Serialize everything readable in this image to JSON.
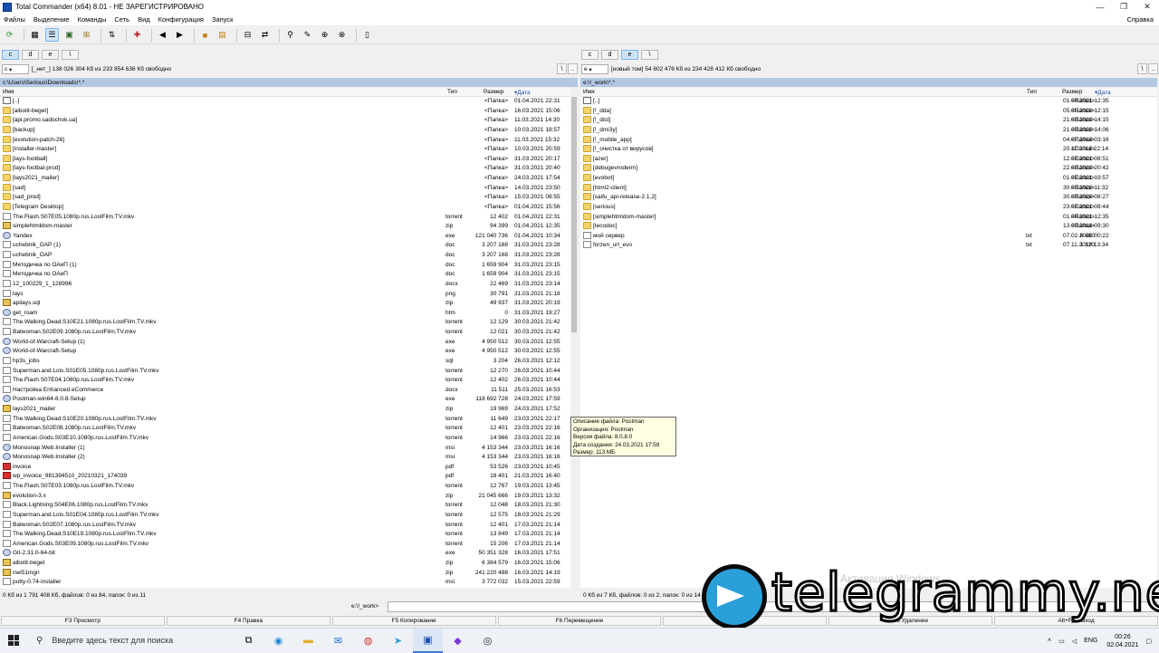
{
  "window": {
    "title": "Total Commander (x64) 8.01 - НЕ ЗАРЕГИСТРИРОВАНО",
    "controls": [
      "—",
      "❐",
      "✕"
    ]
  },
  "menu": {
    "items": [
      "Файлы",
      "Выделение",
      "Команды",
      "Сеть",
      "Вид",
      "Конфигурация",
      "Запуск"
    ],
    "help": "Справка"
  },
  "toolbar": {
    "icons": [
      "refresh-icon",
      "brief-view-icon",
      "detailed-view-icon",
      "thumbnails-icon",
      "tree-icon",
      "invert-selection-icon",
      "pack-icon",
      "back-icon",
      "forward-icon",
      "pack-files-icon",
      "unpack-icon",
      "compare-dirs-icon",
      "sync-dirs-icon",
      "search-icon",
      "multi-rename-icon",
      "ftp-icon",
      "url-ftp-icon",
      "notepad-icon"
    ]
  },
  "left": {
    "drives": [
      "c",
      "d",
      "e",
      "\\"
    ],
    "drive_combo": "c",
    "volume": "[_нет_]",
    "free_info": "138 026 304 Кб из 233 854 636 Кб свободно",
    "path": "c:\\Users\\Serious\\Downloads\\*.*",
    "headers": {
      "name": "Имя",
      "type": "Тип",
      "size": "Размер",
      "date": "Дата"
    },
    "rows": [
      {
        "icon": "up",
        "name": "[..]",
        "type": "",
        "size": "<Папка>",
        "date": "01.04.2021 22:31"
      },
      {
        "icon": "folder",
        "name": "[aibolit-beget]",
        "type": "",
        "size": "<Папка>",
        "date": "16.03.2021 15:06"
      },
      {
        "icon": "folder",
        "name": "[api.promo.sadochok.ua]",
        "type": "",
        "size": "<Папка>",
        "date": "11.03.2021 14:30"
      },
      {
        "icon": "folder",
        "name": "[backup]",
        "type": "",
        "size": "<Папка>",
        "date": "10.03.2021 18:57"
      },
      {
        "icon": "folder",
        "name": "[evolution-patch-26]",
        "type": "",
        "size": "<Папка>",
        "date": "11.03.2021 15:32"
      },
      {
        "icon": "folder",
        "name": "[installer-master]",
        "type": "",
        "size": "<Папка>",
        "date": "10.03.2021 20:59"
      },
      {
        "icon": "folder",
        "name": "[lays-football]",
        "type": "",
        "size": "<Папка>",
        "date": "31.03.2021 20:17"
      },
      {
        "icon": "folder",
        "name": "[lays-footbal-prod]",
        "type": "",
        "size": "<Папка>",
        "date": "31.03.2021 20:40"
      },
      {
        "icon": "folder",
        "name": "[lays2021_mailer]",
        "type": "",
        "size": "<Папка>",
        "date": "24.03.2021 17:54"
      },
      {
        "icon": "folder",
        "name": "[sad]",
        "type": "",
        "size": "<Папка>",
        "date": "14.03.2021 23:50"
      },
      {
        "icon": "folder",
        "name": "[sad_prod]",
        "type": "",
        "size": "<Папка>",
        "date": "15.03.2021 08:55"
      },
      {
        "icon": "folder",
        "name": "[Telegram Desktop]",
        "type": "",
        "size": "<Папка>",
        "date": "01.04.2021 15:56"
      },
      {
        "icon": "file",
        "name": "The.Flash.S07E05.1080p.rus.LostFilm.TV.mkv",
        "type": "torrent",
        "size": "12 402",
        "date": "01.04.2021 22:31"
      },
      {
        "icon": "zip",
        "name": "simplehtmldom-master",
        "type": "zip",
        "size": "94 399",
        "date": "01.04.2021 12:35"
      },
      {
        "icon": "exe",
        "name": "Yandex",
        "type": "exe",
        "size": "121 040 736",
        "date": "01.04.2021 10:34"
      },
      {
        "icon": "file",
        "name": "uchebnik_OAP (1)",
        "type": "doc",
        "size": "3 207 168",
        "date": "31.03.2021 23:28"
      },
      {
        "icon": "file",
        "name": "uchebnik_OAP",
        "type": "doc",
        "size": "3 207 168",
        "date": "31.03.2021 23:28"
      },
      {
        "icon": "file",
        "name": "Методичка по ОАиП (1)",
        "type": "doc",
        "size": "1 659 904",
        "date": "31.03.2021 23:15"
      },
      {
        "icon": "file",
        "name": "Методичка по ОАиП",
        "type": "doc",
        "size": "1 659 904",
        "date": "31.03.2021 23:15"
      },
      {
        "icon": "file",
        "name": "12_100229_1_128996",
        "type": "docx",
        "size": "22 469",
        "date": "31.03.2021 23:14"
      },
      {
        "icon": "file",
        "name": "lays",
        "type": "png",
        "size": "30 791",
        "date": "31.03.2021 21:18"
      },
      {
        "icon": "zip",
        "name": "apilays.sql",
        "type": "zip",
        "size": "49 937",
        "date": "31.03.2021 20:19"
      },
      {
        "icon": "exe",
        "name": "get_roam",
        "type": "htm",
        "size": "0",
        "date": "31.03.2021 19:27"
      },
      {
        "icon": "file",
        "name": "The.Walking.Dead.S10E21.1080p.rus.LostFilm.TV.mkv",
        "type": "torrent",
        "size": "12 129",
        "date": "30.03.2021 21:42"
      },
      {
        "icon": "file",
        "name": "Batwoman.S02E09.1080p.rus.LostFilm.TV.mkv",
        "type": "torrent",
        "size": "12 021",
        "date": "30.03.2021 21:42"
      },
      {
        "icon": "exe",
        "name": "World-of-Warcraft-Setup (1)",
        "type": "exe",
        "size": "4 950 512",
        "date": "30.03.2021 12:55"
      },
      {
        "icon": "exe",
        "name": "World-of-Warcraft-Setup",
        "type": "exe",
        "size": "4 950 512",
        "date": "30.03.2021 12:55"
      },
      {
        "icon": "file",
        "name": "hp3s_jobs",
        "type": "sql",
        "size": "3 204",
        "date": "26.03.2021 12:12"
      },
      {
        "icon": "file",
        "name": "Superman.and.Lois.S01E05.1080p.rus.LostFilm.TV.mkv",
        "type": "torrent",
        "size": "12 270",
        "date": "26.03.2021 10:44"
      },
      {
        "icon": "file",
        "name": "The.Flash.S07E04.1080p.rus.LostFilm.TV.mkv",
        "type": "torrent",
        "size": "12 402",
        "date": "26.03.2021 10:44"
      },
      {
        "icon": "file",
        "name": "Настройка Enhanced eCommerce",
        "type": "docx",
        "size": "11 511",
        "date": "25.03.2021 16:53"
      },
      {
        "icon": "exe",
        "name": "Postman-win64-8.0.8-Setup",
        "type": "exe",
        "size": "118 692 728",
        "date": "24.03.2021 17:59"
      },
      {
        "icon": "zip",
        "name": "lays2021_mailer",
        "type": "zip",
        "size": "19 969",
        "date": "24.03.2021 17:52"
      },
      {
        "icon": "file",
        "name": "The.Walking.Dead.S10E20.1080p.rus.LostFilm.TV.mkv",
        "type": "torrent",
        "size": "11 649",
        "date": "23.03.2021 22:17"
      },
      {
        "icon": "file",
        "name": "Batwoman.S02E08.1080p.rus.LostFilm.TV.mkv",
        "type": "torrent",
        "size": "12 401",
        "date": "23.03.2021 22:16"
      },
      {
        "icon": "file",
        "name": "American.Gods.S03E10.1080p.rus.LostFilm.TV.mkv",
        "type": "torrent",
        "size": "14 966",
        "date": "23.03.2021 22:16"
      },
      {
        "icon": "exe",
        "name": "Monosnap.Web.Installer (1)",
        "type": "msi",
        "size": "4 153 344",
        "date": "23.03.2021 16:16"
      },
      {
        "icon": "exe",
        "name": "Monosnap.Web.Installer (2)",
        "type": "msi",
        "size": "4 153 344",
        "date": "23.03.2021 16:16"
      },
      {
        "icon": "pdf",
        "name": "invoice",
        "type": "pdf",
        "size": "53 526",
        "date": "23.03.2021 10:45"
      },
      {
        "icon": "pdf",
        "name": "wp_invoice_981394510_20210321_174039",
        "type": "pdf",
        "size": "18 401",
        "date": "21.03.2021 16:40"
      },
      {
        "icon": "file",
        "name": "The.Flash.S07E03.1080p.rus.LostFilm.TV.mkv",
        "type": "torrent",
        "size": "12 767",
        "date": "19.03.2021 13:45"
      },
      {
        "icon": "zip",
        "name": "evolution-3.x",
        "type": "zip",
        "size": "21 045 666",
        "date": "19.03.2021 13:32"
      },
      {
        "icon": "file",
        "name": "Black.Lightning.S04E06.1080p.rus.LostFilm.TV.mkv",
        "type": "torrent",
        "size": "12 048",
        "date": "18.03.2021 21:30"
      },
      {
        "icon": "file",
        "name": "Superman.and.Lois.S01E04.1080p.rus.LostFilm.TV.mkv",
        "type": "torrent",
        "size": "12 575",
        "date": "18.03.2021 21:29"
      },
      {
        "icon": "file",
        "name": "Batwoman.S02E07.1080p.rus.LostFilm.TV.mkv",
        "type": "torrent",
        "size": "12 401",
        "date": "17.03.2021 21:14"
      },
      {
        "icon": "file",
        "name": "The.Walking.Dead.S10E19.1080p.rus.LostFilm.TV.mkv",
        "type": "torrent",
        "size": "13 849",
        "date": "17.03.2021 21:14"
      },
      {
        "icon": "file",
        "name": "American.Gods.S03E09.1080p.rus.LostFilm.TV.mkv",
        "type": "torrent",
        "size": "15 206",
        "date": "17.03.2021 21:14"
      },
      {
        "icon": "exe",
        "name": "Git-2.31.0-64-bit",
        "type": "exe",
        "size": "50 351 328",
        "date": "16.03.2021 17:51"
      },
      {
        "icon": "zip",
        "name": "aibolit-beget",
        "type": "zip",
        "size": "6 384 579",
        "date": "16.03.2021 15:06"
      },
      {
        "icon": "zip",
        "name": "nwi51mgn",
        "type": "zip",
        "size": "241 220 488",
        "date": "16.03.2021 14:19"
      },
      {
        "icon": "file",
        "name": "putty-0.74-installer",
        "type": "msi",
        "size": "3 772 032",
        "date": "15.03.2021 22:59"
      }
    ],
    "status": "0 Кб из 1 791 408 Кб, файлов: 0 из 84, папок: 0 из 11"
  },
  "right": {
    "drives": [
      "c",
      "d",
      "e",
      "\\"
    ],
    "drive_combo": "e",
    "volume": "[новый том]",
    "free_info": "54 602 476 Кб из 234 428 412 Кб свободно",
    "path": "e:\\!_work\\*.*",
    "headers": {
      "name": "Имя",
      "type": "Тип",
      "size": "Размер",
      "date": "Дата"
    },
    "rows": [
      {
        "icon": "up",
        "name": "[..]",
        "type": "",
        "size": "<Папка>",
        "date": "01.04.2021 12:35"
      },
      {
        "icon": "folder",
        "name": "[!_dda]",
        "type": "",
        "size": "<Папка>",
        "date": "05.05.2020 12:15"
      },
      {
        "icon": "folder",
        "name": "[!_dist]",
        "type": "",
        "size": "<Папка>",
        "date": "21.03.2020 14:15"
      },
      {
        "icon": "folder",
        "name": "[!_dmi3y]",
        "type": "",
        "size": "<Папка>",
        "date": "21.03.2020 14:06"
      },
      {
        "icon": "folder",
        "name": "[!_mobile_app]",
        "type": "",
        "size": "<Папка>",
        "date": "04.07.2018 03:16"
      },
      {
        "icon": "folder",
        "name": "[!_очистка от вирусов]",
        "type": "",
        "size": "<Папка>",
        "date": "20.11.2018 22:14"
      },
      {
        "icon": "folder",
        "name": "[azer]",
        "type": "",
        "size": "<Папка>",
        "date": "12.01.2021 08:51"
      },
      {
        "icon": "folder",
        "name": "[debugevroderm]",
        "type": "",
        "size": "<Папка>",
        "date": "22.03.2020 20:42"
      },
      {
        "icon": "folder",
        "name": "[evobot]",
        "type": "",
        "size": "<Папка>",
        "date": "01.01.2021 19:57"
      },
      {
        "icon": "folder",
        "name": "[html2-client]",
        "type": "",
        "size": "<Папка>",
        "date": "30.03.2020 11:32"
      },
      {
        "icon": "folder",
        "name": "[saifu_api-release-2.1.2]",
        "type": "",
        "size": "<Папка>",
        "date": "30.03.2020 08:27"
      },
      {
        "icon": "folder",
        "name": "[serious]",
        "type": "",
        "size": "<Папка>",
        "date": "23.01.2021 08:44"
      },
      {
        "icon": "folder",
        "name": "[simplehtmldom-master]",
        "type": "",
        "size": "<Папка>",
        "date": "01.04.2021 12:35"
      },
      {
        "icon": "folder",
        "name": "[tecodoc]",
        "type": "",
        "size": "<Папка>",
        "date": "13.03.2018 09:30"
      },
      {
        "icon": "file",
        "name": "мой сервер",
        "type": "txt",
        "size": "6 460",
        "date": "07.02.2020 00:22"
      },
      {
        "icon": "file",
        "name": "forzen_url_evo",
        "type": "txt",
        "size": "1 120",
        "date": "07.11.2018 13:34"
      }
    ],
    "status": "0 Кб из 7 Кб, файлов: 0 из 2, папок: 0 из 14"
  },
  "cmdline": {
    "label": "e:\\!_work>",
    "value": ""
  },
  "fkeys": [
    "F3 Просмотр",
    "F4 Правка",
    "F5 Копирование",
    "F6 Перемещение",
    "алог",
    "F8 Удаление",
    "Alt+F4 Выход"
  ],
  "tooltip": [
    "Описание файла: Postman",
    "Организация: Postman",
    "Версия файла: 8.0.8.0",
    "Дата создания: 24.03.2021 17:59",
    "Размер: 113 МБ"
  ],
  "watermark": "Активация Windows",
  "brand": "telegrammy.net",
  "taskbar": {
    "search_placeholder": "Введите здесь текст для поиска",
    "apps": [
      "task-view-icon",
      "edge-icon",
      "explorer-icon",
      "mail-icon",
      "chrome-icon",
      "telegram-icon",
      "total-commander-icon",
      "phpstorm-icon",
      "steam-icon"
    ],
    "lang": "ENG",
    "time": "00:26",
    "date": "02.04.2021"
  }
}
